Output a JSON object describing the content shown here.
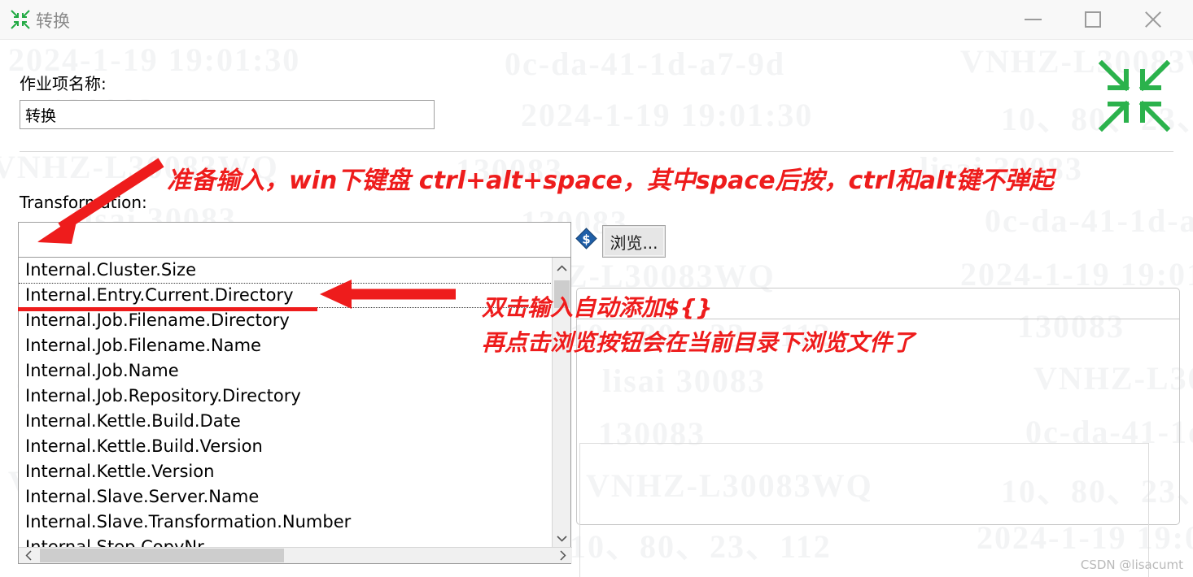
{
  "window": {
    "title": "转换",
    "icon": "collapse-arrows-icon",
    "accent_green": "#22aa44",
    "controls": {
      "minimize": "minimize-icon",
      "maximize": "maximize-icon",
      "close": "close-icon"
    }
  },
  "form": {
    "job_entry_name_label": "作业项名称:",
    "job_entry_name_value": "转换",
    "transformation_label": "Transformation:",
    "transformation_value": "",
    "variable_icon": "dollar-variable-icon",
    "browse_button": "浏览..."
  },
  "dropdown": {
    "items": [
      "Internal.Cluster.Size",
      "Internal.Entry.Current.Directory",
      "Internal.Job.Filename.Directory",
      "Internal.Job.Filename.Name",
      "Internal.Job.Name",
      "Internal.Job.Repository.Directory",
      "Internal.Kettle.Build.Date",
      "Internal.Kettle.Build.Version",
      "Internal.Kettle.Version",
      "Internal.Slave.Server.Name",
      "Internal.Slave.Transformation.Number",
      "Internal.Step.CopyNr"
    ],
    "focused_index": 1,
    "scroll_up_icon": "chevron-up-icon",
    "scroll_down_icon": "chevron-down-icon",
    "scroll_left_icon": "chevron-left-icon",
    "scroll_right_icon": "chevron-right-icon"
  },
  "annotations": {
    "color": "#ee1c1c",
    "line1": "准备输入，win下键盘 ctrl+alt+space，其中space后按，ctrl和alt键不弹起",
    "line2": "双击输入自动添加${}",
    "line3": "再点击浏览按钮会在当前目录下浏览文件了"
  },
  "watermark": {
    "signature": "CSDN @lisacumt",
    "tiles": [
      "lisai  30083",
      "130083",
      "VNHZ-L30083WQ",
      "10、80、23、112",
      "0c-da-41-1d-a7-9d",
      "2024-1-19 19:01:30"
    ]
  }
}
